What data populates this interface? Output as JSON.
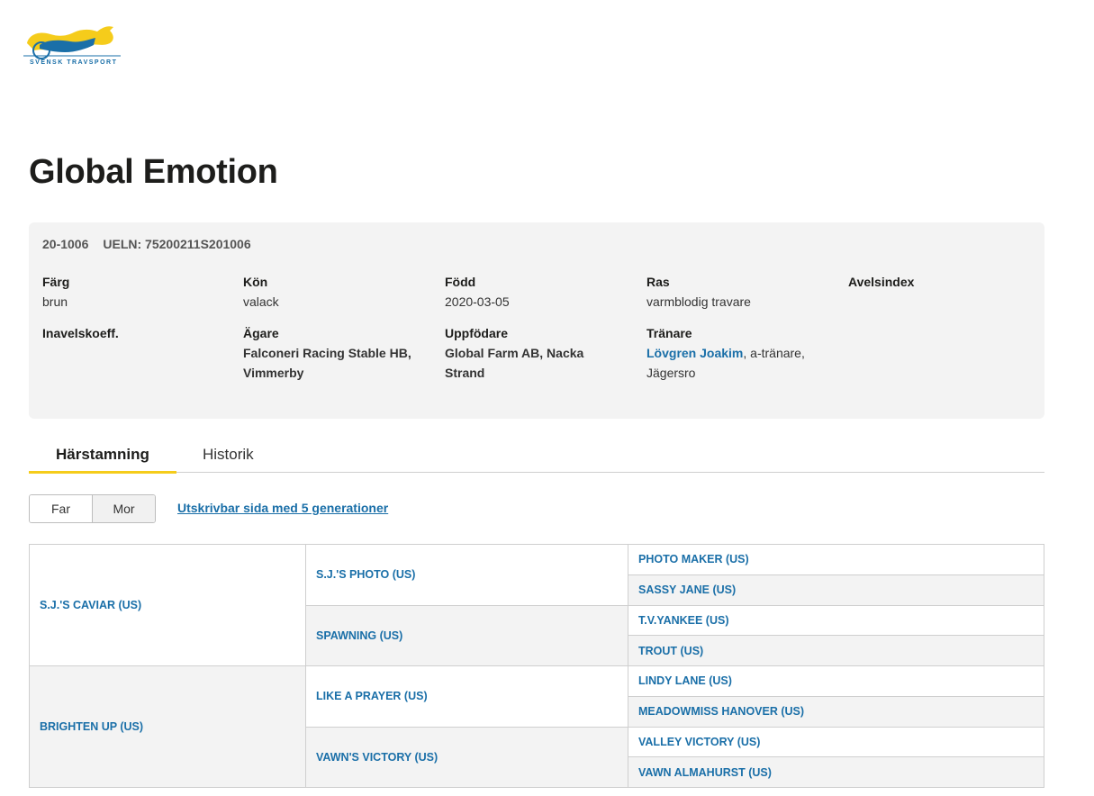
{
  "brand": {
    "logo_text": "SVENSK TRAVSPORT",
    "colors": {
      "yellow": "#f5cc1b",
      "blue": "#1a6fa8"
    }
  },
  "horse": {
    "name": "Global Emotion",
    "reg_no": "20-1006",
    "ueln": "UELN: 75200211S201006"
  },
  "info": {
    "farg_label": "Färg",
    "farg_value": "brun",
    "kon_label": "Kön",
    "kon_value": "valack",
    "fodd_label": "Född",
    "fodd_value": "2020-03-05",
    "ras_label": "Ras",
    "ras_value": "varmblodig travare",
    "avelsindex_label": "Avelsindex",
    "inavel_label": "Inavelskoeff.",
    "agare_label": "Ägare",
    "agare_line1": "Falconeri Racing Stable HB,",
    "agare_line2": "Vimmerby",
    "uppfodare_label": "Uppfödare",
    "uppfodare_line1": "Global Farm AB, Nacka",
    "uppfodare_line2": "Strand",
    "tranare_label": "Tränare",
    "tranare_link": "Lövgren Joakim",
    "tranare_suffix": ", a-tränare,",
    "tranare_line2": "Jägersro"
  },
  "tabs": {
    "active": "Härstamning",
    "inactive": "Historik"
  },
  "toggle": {
    "far": "Far",
    "mor": "Mor"
  },
  "print_link": "Utskrivbar sida med 5 generationer",
  "pedigree": {
    "gen1": [
      "S.J.'S CAVIAR (US)",
      "BRIGHTEN UP (US)"
    ],
    "gen2": [
      "S.J.'S PHOTO (US)",
      "SPAWNING (US)",
      "LIKE A PRAYER (US)",
      "VAWN'S VICTORY (US)"
    ],
    "gen3": [
      "PHOTO MAKER (US)",
      "SASSY JANE (US)",
      "T.V.YANKEE (US)",
      "TROUT (US)",
      "LINDY LANE (US)",
      "MEADOWMISS HANOVER (US)",
      "VALLEY VICTORY (US)",
      "VAWN ALMAHURST (US)"
    ]
  }
}
